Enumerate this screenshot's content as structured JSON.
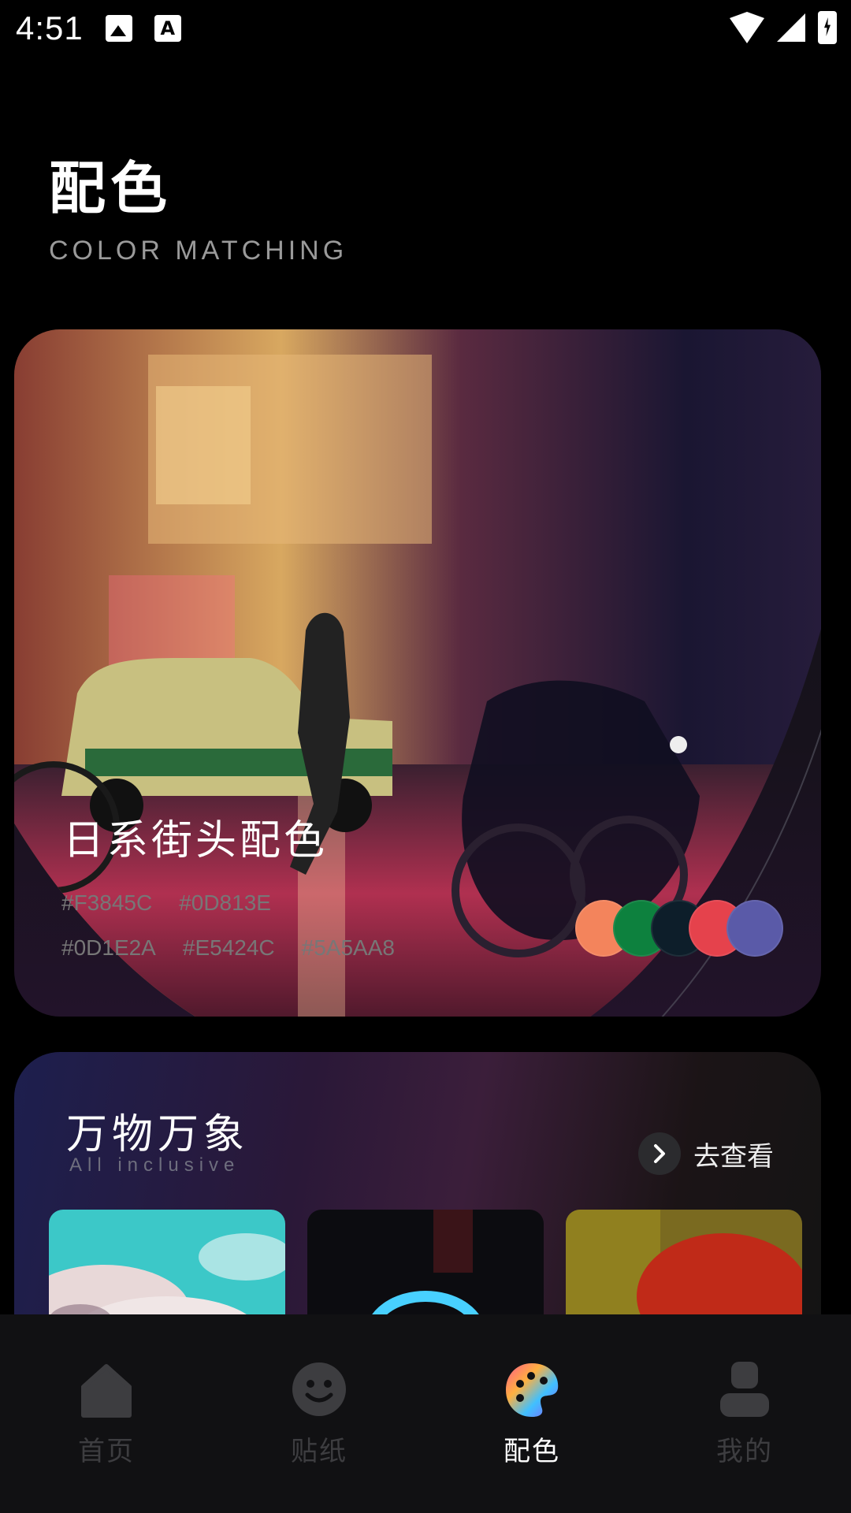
{
  "status_bar": {
    "time": "4:51"
  },
  "header": {
    "title": "配色",
    "subtitle": "COLOR MATCHING"
  },
  "palette_card": {
    "name": "日系街头配色",
    "hex_row1": [
      "#F3845C",
      "#0D813E"
    ],
    "hex_row2": [
      "#0D1E2A",
      "#E5424C",
      "#5A5AA8"
    ],
    "swatch_colors": [
      "#F3845C",
      "#0D813E",
      "#0D1E2A",
      "#E5424C",
      "#5A5AA8"
    ]
  },
  "collection": {
    "title": "万物万象",
    "subtitle": "All inclusive",
    "goto_label": "去查看"
  },
  "bottom_nav": {
    "items": [
      {
        "label": "首页",
        "icon": "home-icon"
      },
      {
        "label": "贴纸",
        "icon": "smiley-icon"
      },
      {
        "label": "配色",
        "icon": "palette-icon"
      },
      {
        "label": "我的",
        "icon": "user-icon"
      }
    ],
    "active": "配色"
  }
}
